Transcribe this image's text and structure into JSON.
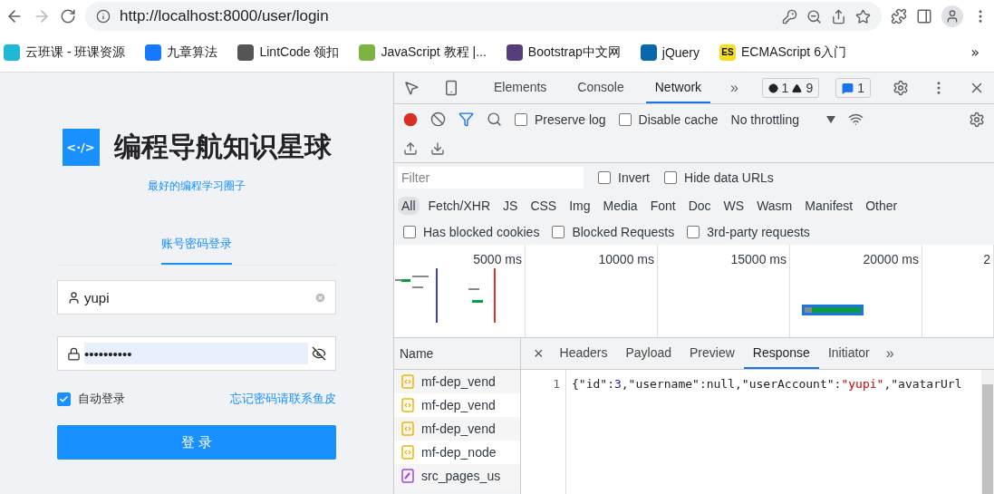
{
  "browser": {
    "url": "http://localhost:8000/user/login",
    "bookmarks": [
      {
        "label": "云班课 - 班课资源",
        "color": "#1fb8d6"
      },
      {
        "label": "九章算法",
        "color": "#1677ff"
      },
      {
        "label": "LintCode 领扣",
        "color": "#555555"
      },
      {
        "label": "JavaScript 教程 |...",
        "color": "#7cb342"
      },
      {
        "label": "Bootstrap中文网",
        "color": "#563d7c"
      },
      {
        "label": "jQuery",
        "color": "#0769ad"
      },
      {
        "label": "ECMAScript 6入门",
        "color": "#f7df1e",
        "badge": "ES"
      }
    ],
    "more": "»"
  },
  "login": {
    "logo": "<·/>",
    "title": "编程导航知识星球",
    "subtitle": "最好的编程学习圈子",
    "tabs": [
      {
        "label": "账号密码登录",
        "selected": true
      }
    ],
    "username": {
      "value": "yupi"
    },
    "password": {
      "value": "••••••••••"
    },
    "remember": {
      "label": "自动登录",
      "checked": true
    },
    "forgot": "忘记密码请联系鱼皮",
    "submit": "登 录"
  },
  "devtools": {
    "tabs": [
      {
        "label": "Elements",
        "selected": false
      },
      {
        "label": "Console",
        "selected": false
      },
      {
        "label": "Network",
        "selected": true
      }
    ],
    "more_tabs": "»",
    "errors": "1",
    "warnings": "9",
    "messages": "1",
    "preserve_log": {
      "label": "Preserve log",
      "checked": false
    },
    "disable_cache": {
      "label": "Disable cache",
      "checked": false
    },
    "throttling": "No throttling",
    "filter": {
      "placeholder": "Filter"
    },
    "invert": {
      "label": "Invert",
      "checked": false
    },
    "hide_data_urls": {
      "label": "Hide data URLs",
      "checked": false
    },
    "types": [
      {
        "label": "All",
        "selected": true
      },
      {
        "label": "Fetch/XHR",
        "selected": false
      },
      {
        "label": "JS",
        "selected": false
      },
      {
        "label": "CSS",
        "selected": false
      },
      {
        "label": "Img",
        "selected": false
      },
      {
        "label": "Media",
        "selected": false
      },
      {
        "label": "Font",
        "selected": false
      },
      {
        "label": "Doc",
        "selected": false
      },
      {
        "label": "WS",
        "selected": false
      },
      {
        "label": "Wasm",
        "selected": false
      },
      {
        "label": "Manifest",
        "selected": false
      },
      {
        "label": "Other",
        "selected": false
      }
    ],
    "blocked": [
      {
        "label": "Has blocked cookies",
        "checked": false
      },
      {
        "label": "Blocked Requests",
        "checked": false
      },
      {
        "label": "3rd-party requests",
        "checked": false
      }
    ],
    "timeline_ticks": [
      "5000 ms",
      "10000 ms",
      "15000 ms",
      "20000 ms",
      "2"
    ],
    "name_header": "Name",
    "requests": [
      {
        "name": "mf-dep_vend",
        "kind": "script"
      },
      {
        "name": "mf-dep_vend",
        "kind": "script"
      },
      {
        "name": "mf-dep_vend",
        "kind": "script"
      },
      {
        "name": "mf-dep_node",
        "kind": "script"
      },
      {
        "name": "src_pages_us",
        "kind": "style"
      }
    ],
    "detail_tabs": [
      {
        "label": "Headers",
        "selected": false
      },
      {
        "label": "Payload",
        "selected": false
      },
      {
        "label": "Preview",
        "selected": false
      },
      {
        "label": "Response",
        "selected": true
      },
      {
        "label": "Initiator",
        "selected": false
      }
    ],
    "close": "×",
    "response": {
      "line_number": "1",
      "tokens": [
        {
          "text": "{\"id\":",
          "kind": "plain"
        },
        {
          "text": "3",
          "kind": "number"
        },
        {
          "text": ",\"username\":null,\"userAccount\":",
          "kind": "plain"
        },
        {
          "text": "\"yupi\"",
          "kind": "string"
        },
        {
          "text": ",\"avatarUrl",
          "kind": "plain"
        }
      ]
    }
  }
}
